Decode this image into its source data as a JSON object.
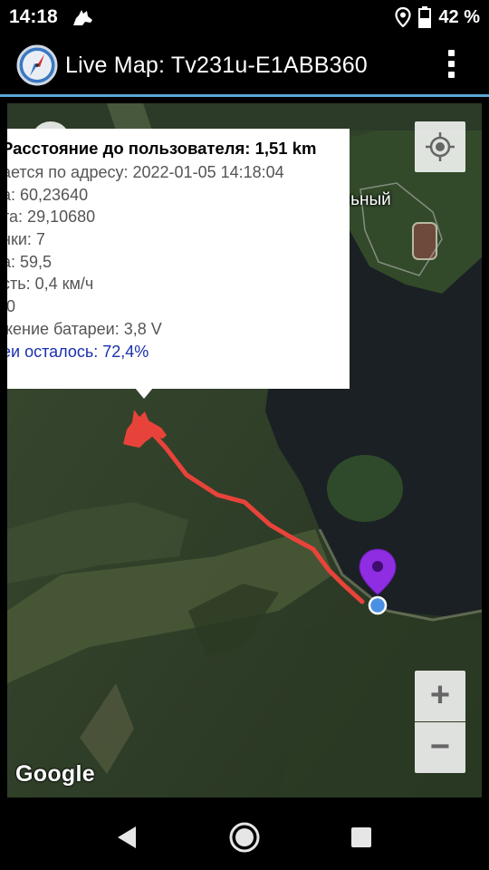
{
  "status_bar": {
    "time": "14:18",
    "battery_percent": "42 %",
    "icons": [
      "dog-notification-icon",
      "location-icon",
      "battery-icon"
    ]
  },
  "app_bar": {
    "title": "Live Map: Tv231u-E1ABB360",
    "icons": [
      "compass-app-icon",
      "overflow-menu-icon"
    ]
  },
  "map": {
    "place_label": "льный",
    "attribution": "Google",
    "controls": {
      "my_location": "my-location-icon",
      "zoom_in": "+",
      "zoom_out": "−",
      "compass": "compass-icon"
    },
    "track_color": "#e8433a",
    "user_pin_color": "#8e2de2",
    "info_window": {
      "title": "Расстояние до пользователя: 1,51 km",
      "lines": [
        "ается по адресу: 2022-01-05 14:18:04",
        "а: 60,23640",
        "та: 29,10680",
        "нки: 7",
        "а: 59,5",
        "сть: 0,4 км/ч",
        ",0",
        "жение батареи: 3,8 V"
      ],
      "battery_line": "еи осталось: 72,4%"
    }
  },
  "nav_bar": {
    "icons": [
      "back-icon",
      "home-icon",
      "recents-icon"
    ]
  }
}
